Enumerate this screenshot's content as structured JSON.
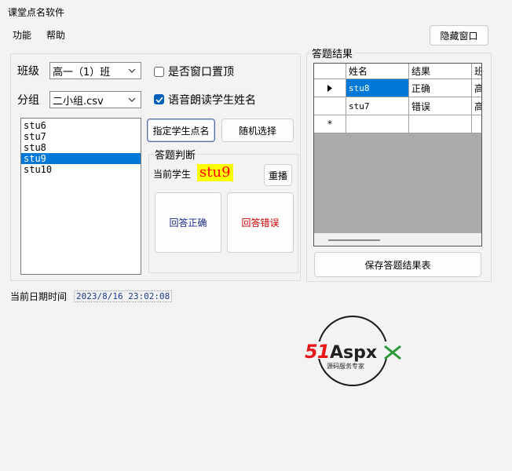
{
  "window": {
    "title": "课堂点名软件",
    "hide_button": "隐藏窗口"
  },
  "menu": {
    "items": [
      "功能",
      "帮助"
    ]
  },
  "left": {
    "class_label": "班级",
    "class_value": "高一（1）班",
    "group_label": "分组",
    "group_value": "二小组.csv",
    "topmost_label": "是否窗口置顶",
    "topmost_checked": false,
    "voice_label": "语音朗读学生姓名",
    "voice_checked": true,
    "students": [
      "stu6",
      "stu7",
      "stu8",
      "stu9",
      "stu10"
    ],
    "selected_student": "stu9",
    "assign_button": "指定学生点名",
    "random_button": "随机选择",
    "judge": {
      "title": "答题判断",
      "current_label": "当前学生",
      "current_name": "stu9",
      "replay_button": "重播",
      "correct_button": "回答正确",
      "wrong_button": "回答错误",
      "correct_color": "#1a2a8a",
      "wrong_color": "#cc0000"
    },
    "datetime_label": "当前日期时间",
    "datetime_value": "2023/8/16 23:02:08"
  },
  "results": {
    "title": "答题结果",
    "columns": [
      "姓名",
      "结果",
      "班"
    ],
    "rows": [
      [
        "stu8",
        "正确",
        "高"
      ],
      [
        "stu7",
        "错误",
        "高"
      ]
    ],
    "new_row_marker": "*",
    "current_row_marker": "▶",
    "save_button": "保存答题结果表"
  },
  "logo": {
    "text": "51Aspx",
    "tagline": "源码服务专家",
    "accent": "#e8191a",
    "accent2": "#2c9a3a"
  }
}
